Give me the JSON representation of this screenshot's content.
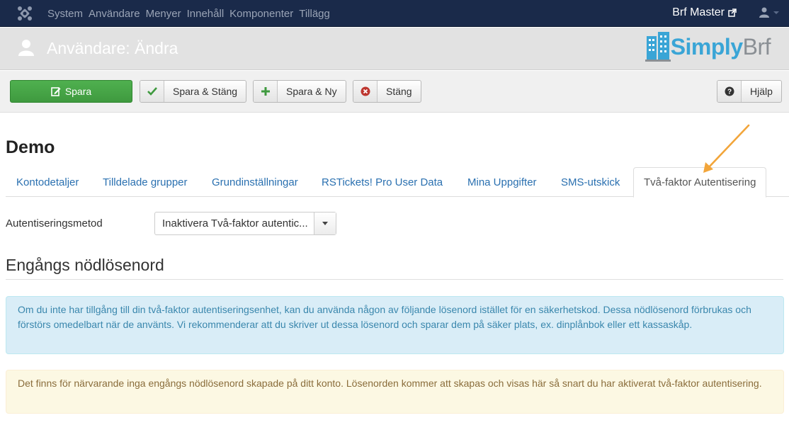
{
  "navbar": {
    "menu": [
      "System",
      "Användare",
      "Menyer",
      "Innehåll",
      "Komponenter",
      "Tillägg"
    ],
    "site_name": "Brf Master"
  },
  "header": {
    "title": "Användare: Ändra",
    "brand_primary": "Simply",
    "brand_secondary": "Brf"
  },
  "toolbar": {
    "save": "Spara",
    "save_close": "Spara & Stäng",
    "save_new": "Spara & Ny",
    "close": "Stäng",
    "help": "Hjälp"
  },
  "user": {
    "name": "Demo"
  },
  "tabs": [
    "Kontodetaljer",
    "Tilldelade grupper",
    "Grundinställningar",
    "RSTickets! Pro User Data",
    "Mina Uppgifter",
    "SMS-utskick",
    "Två-faktor Autentisering"
  ],
  "form": {
    "auth_method_label": "Autentiseringsmetod",
    "auth_method_value": "Inaktivera Två-faktor autentic..."
  },
  "section": {
    "title": "Engångs nödlösenord"
  },
  "alerts": {
    "info": "Om du inte har tillgång till din två-faktor autentiseringsenhet, kan du använda någon av följande lösenord istället för en säkerhetskod. Dessa nödlösenord förbrukas och förstörs omedelbart när de använts. Vi rekommenderar att du skriver ut dessa lösenord och sparar dem på säker plats, ex. dinplånbok eller ett kassaskåp.",
    "warning": "Det finns för närvarande inga engångs nödlösenord skapade på ditt konto. Lösenorden kommer att skapas och visas här så snart du har aktiverat två-faktor autentisering."
  },
  "colors": {
    "navbar": "#1a2a4a",
    "save_button": "#46a546",
    "link": "#2a70b0",
    "annotation_arrow": "#f2a53a"
  }
}
